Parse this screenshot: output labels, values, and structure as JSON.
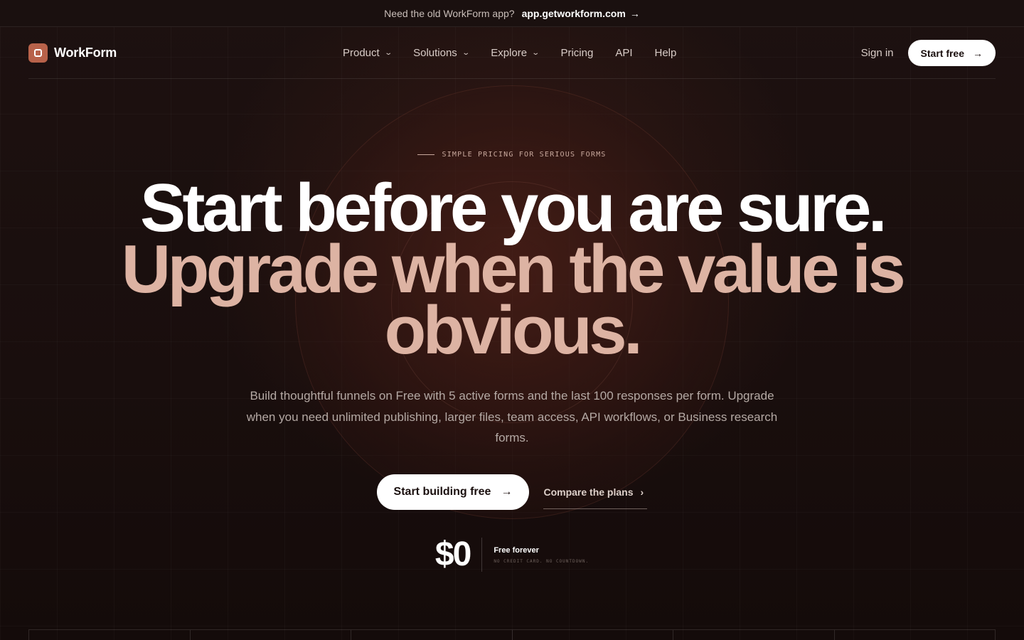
{
  "announcement": {
    "text": "Need the old WorkForm app?",
    "link_label": "app.getworkform.com",
    "arrow": "→"
  },
  "nav": {
    "brand": "WorkForm",
    "items": [
      {
        "label": "Product",
        "has_dropdown": true
      },
      {
        "label": "Solutions",
        "has_dropdown": true
      },
      {
        "label": "Explore",
        "has_dropdown": true
      },
      {
        "label": "Pricing",
        "has_dropdown": false
      },
      {
        "label": "API",
        "has_dropdown": false
      },
      {
        "label": "Help",
        "has_dropdown": false
      }
    ],
    "signin": "Sign in",
    "cta": "Start free",
    "cta_arrow": "→"
  },
  "hero": {
    "eyebrow": "SIMPLE PRICING FOR SERIOUS FORMS",
    "headline_line1": "Start before you are sure.",
    "headline_line2": "Upgrade when the value is obvious.",
    "subtitle": "Build thoughtful funnels on Free with 5 active forms and the last 100 responses per form. Upgrade when you need unlimited publishing, larger files, team access, API workflows, or Business research forms.",
    "primary_cta": "Start building free",
    "primary_arrow": "→",
    "secondary_cta": "Compare the plans",
    "secondary_arrow": "›",
    "price": "$0",
    "price_label": "Free forever",
    "price_note": "NO CREDIT CARD. NO COUNTDOWN."
  },
  "colors": {
    "background": "#1a0f0e",
    "accent": "#b8624a",
    "headline_secondary": "#ddb3a3"
  }
}
